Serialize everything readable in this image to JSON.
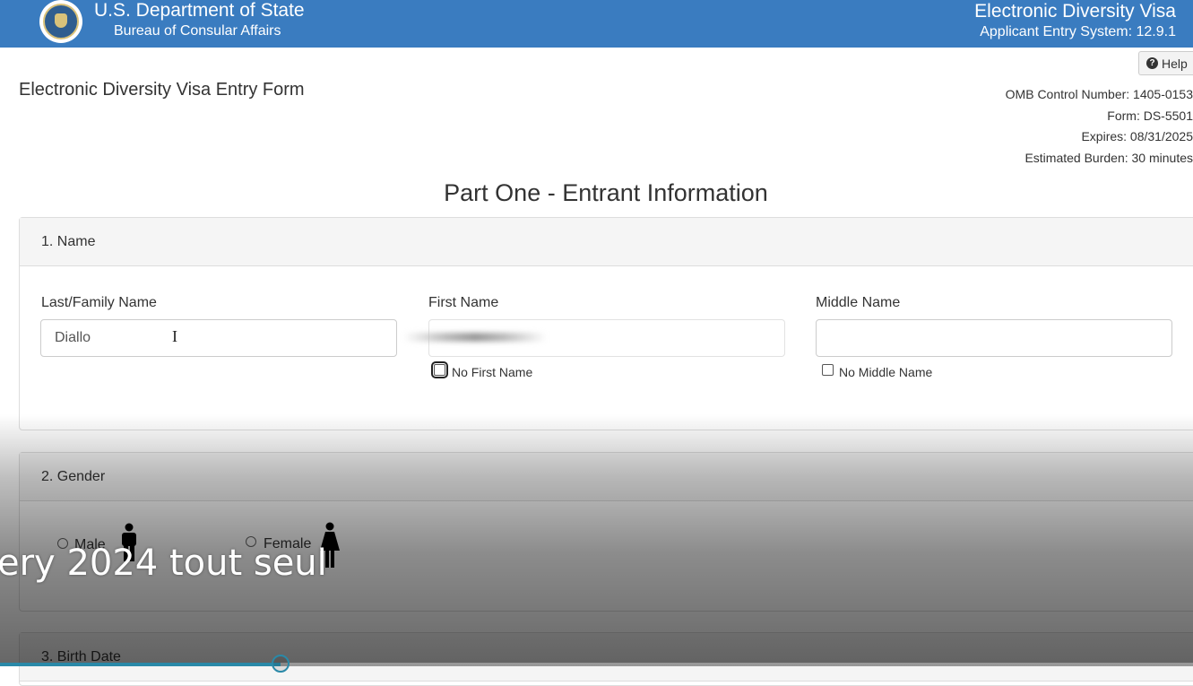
{
  "header": {
    "dept": "U.S. Department of State",
    "bureau": "Bureau of Consular Affairs",
    "system_title": "Electronic Diversity Visa",
    "system_sub": "Applicant Entry System: 12.9.1"
  },
  "help_label": "Help",
  "form_title": "Electronic Diversity Visa Entry Form",
  "omb": {
    "control": "OMB Control Number: 1405-0153",
    "form": "Form: DS-5501",
    "expires": "Expires: 08/31/2025",
    "burden": "Estimated Burden: 30 minutes"
  },
  "part_title": "Part One - Entrant Information",
  "name_section": {
    "heading": "1. Name",
    "last_label": "Last/Family Name",
    "last_value": "Diallo",
    "first_label": "First Name",
    "first_value": "",
    "middle_label": "Middle Name",
    "middle_value": "",
    "no_first": "No First Name",
    "no_middle": "No Middle Name"
  },
  "gender_section": {
    "heading": "2. Gender",
    "male": "Male",
    "female": "Female"
  },
  "birth_section": {
    "heading": "3. Birth Date"
  },
  "video": {
    "caption": "ery 2024 tout seul",
    "progress": 0.235
  },
  "colors": {
    "header_bg": "#3a7cc0",
    "progress": "#2a89a8"
  }
}
